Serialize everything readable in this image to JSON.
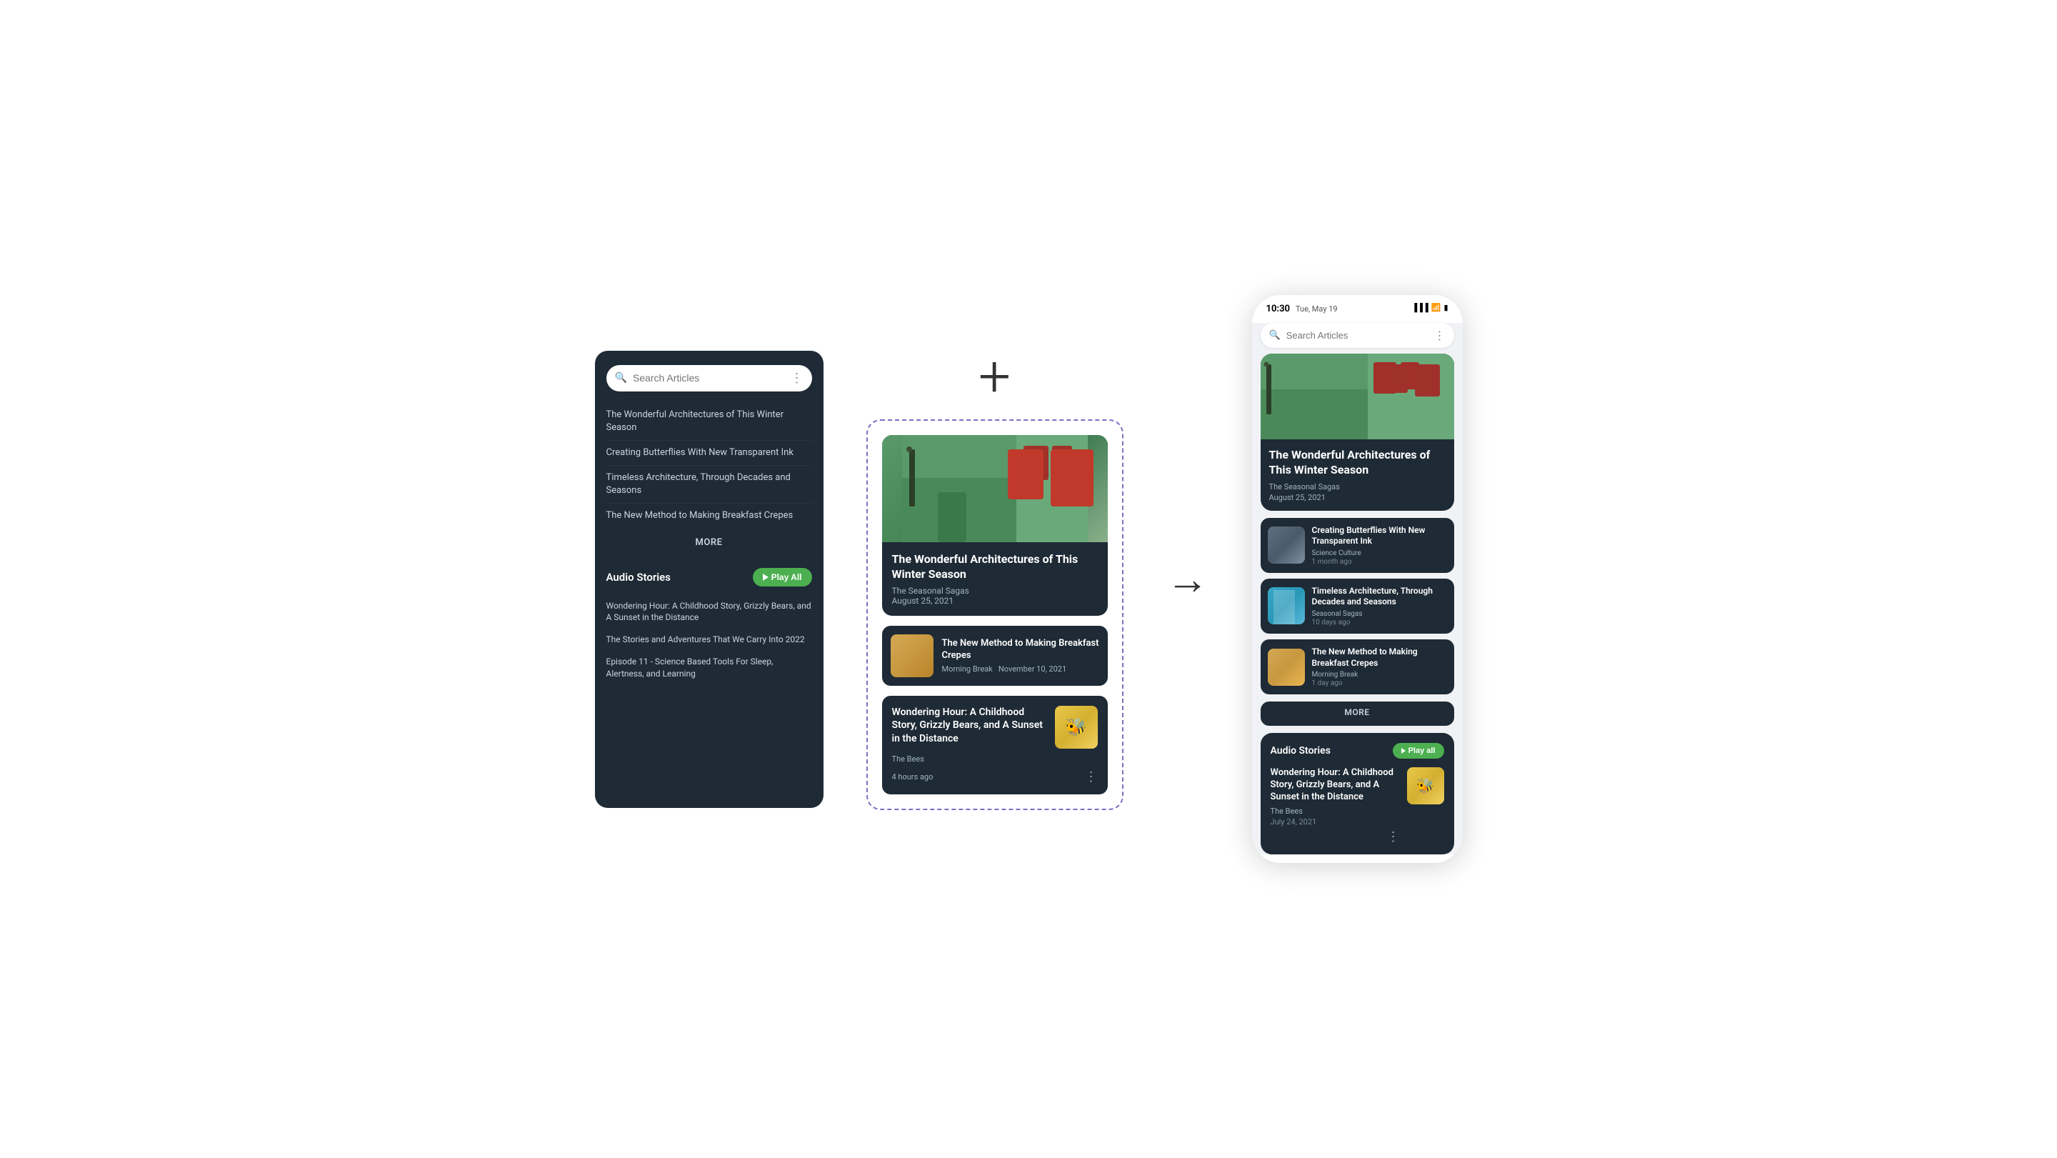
{
  "left_phone": {
    "search_placeholder": "Search Articles",
    "articles": [
      "The Wonderful Architectures of This Winter Season",
      "Creating Butterflies With New Transparent Ink",
      "Timeless Architecture, Through Decades and Seasons",
      "The New Method to Making Breakfast Crepes"
    ],
    "more_label": "MORE",
    "audio_section_title": "Audio Stories",
    "play_all_label": "Play All",
    "audio_items": [
      "Wondering Hour: A Childhood Story, Grizzly Bears, and A Sunset in the Distance",
      "The Stories and Adventures That We Carry Into 2022",
      "Episode 11 - Science Based Tools For Sleep, Alertness, and Learning"
    ]
  },
  "middle": {
    "plus_sign": "+",
    "featured_article": {
      "title": "The Wonderful Architectures of This Winter Season",
      "source": "The Seasonal Sagas",
      "date": "August 25, 2021"
    },
    "small_article": {
      "title": "The New Method to Making Breakfast Crepes",
      "source": "Morning Break",
      "date": "November 10, 2021"
    },
    "audio_item": {
      "title": "Wondering Hour: A Childhood Story, Grizzly Bears, and A Sunset in the Distance",
      "source": "The Bees",
      "time": "4 hours ago"
    }
  },
  "arrow": "→",
  "right_phone": {
    "status_bar": {
      "time": "10:30",
      "date": "Tue, May 19"
    },
    "search_placeholder": "Search Articles",
    "featured": {
      "title": "The Wonderful Architectures of This Winter Season",
      "source": "The Seasonal Sagas",
      "date": "August 25, 2021"
    },
    "articles": [
      {
        "title": "Creating Butterflies With New Transparent Ink",
        "source": "Science Culture",
        "meta": "1 month ago",
        "thumb": "butterfly"
      },
      {
        "title": "Timeless Architecture, Through Decades and Seasons",
        "source": "Seasonal Sagas",
        "meta": "10 days ago",
        "thumb": "architecture"
      },
      {
        "title": "The New Method to Making Breakfast Crepes",
        "source": "Morning Break",
        "meta": "1 day ago",
        "thumb": "breakfast"
      }
    ],
    "more_label": "MORE",
    "audio_section": {
      "title": "Audio Stories",
      "play_all_label": "Play all",
      "item": {
        "title": "Wondering Hour: A Childhood Story, Grizzly Bears, and A Sunset in the Distance",
        "source": "The Bees",
        "date": "July 24, 2021"
      }
    }
  }
}
